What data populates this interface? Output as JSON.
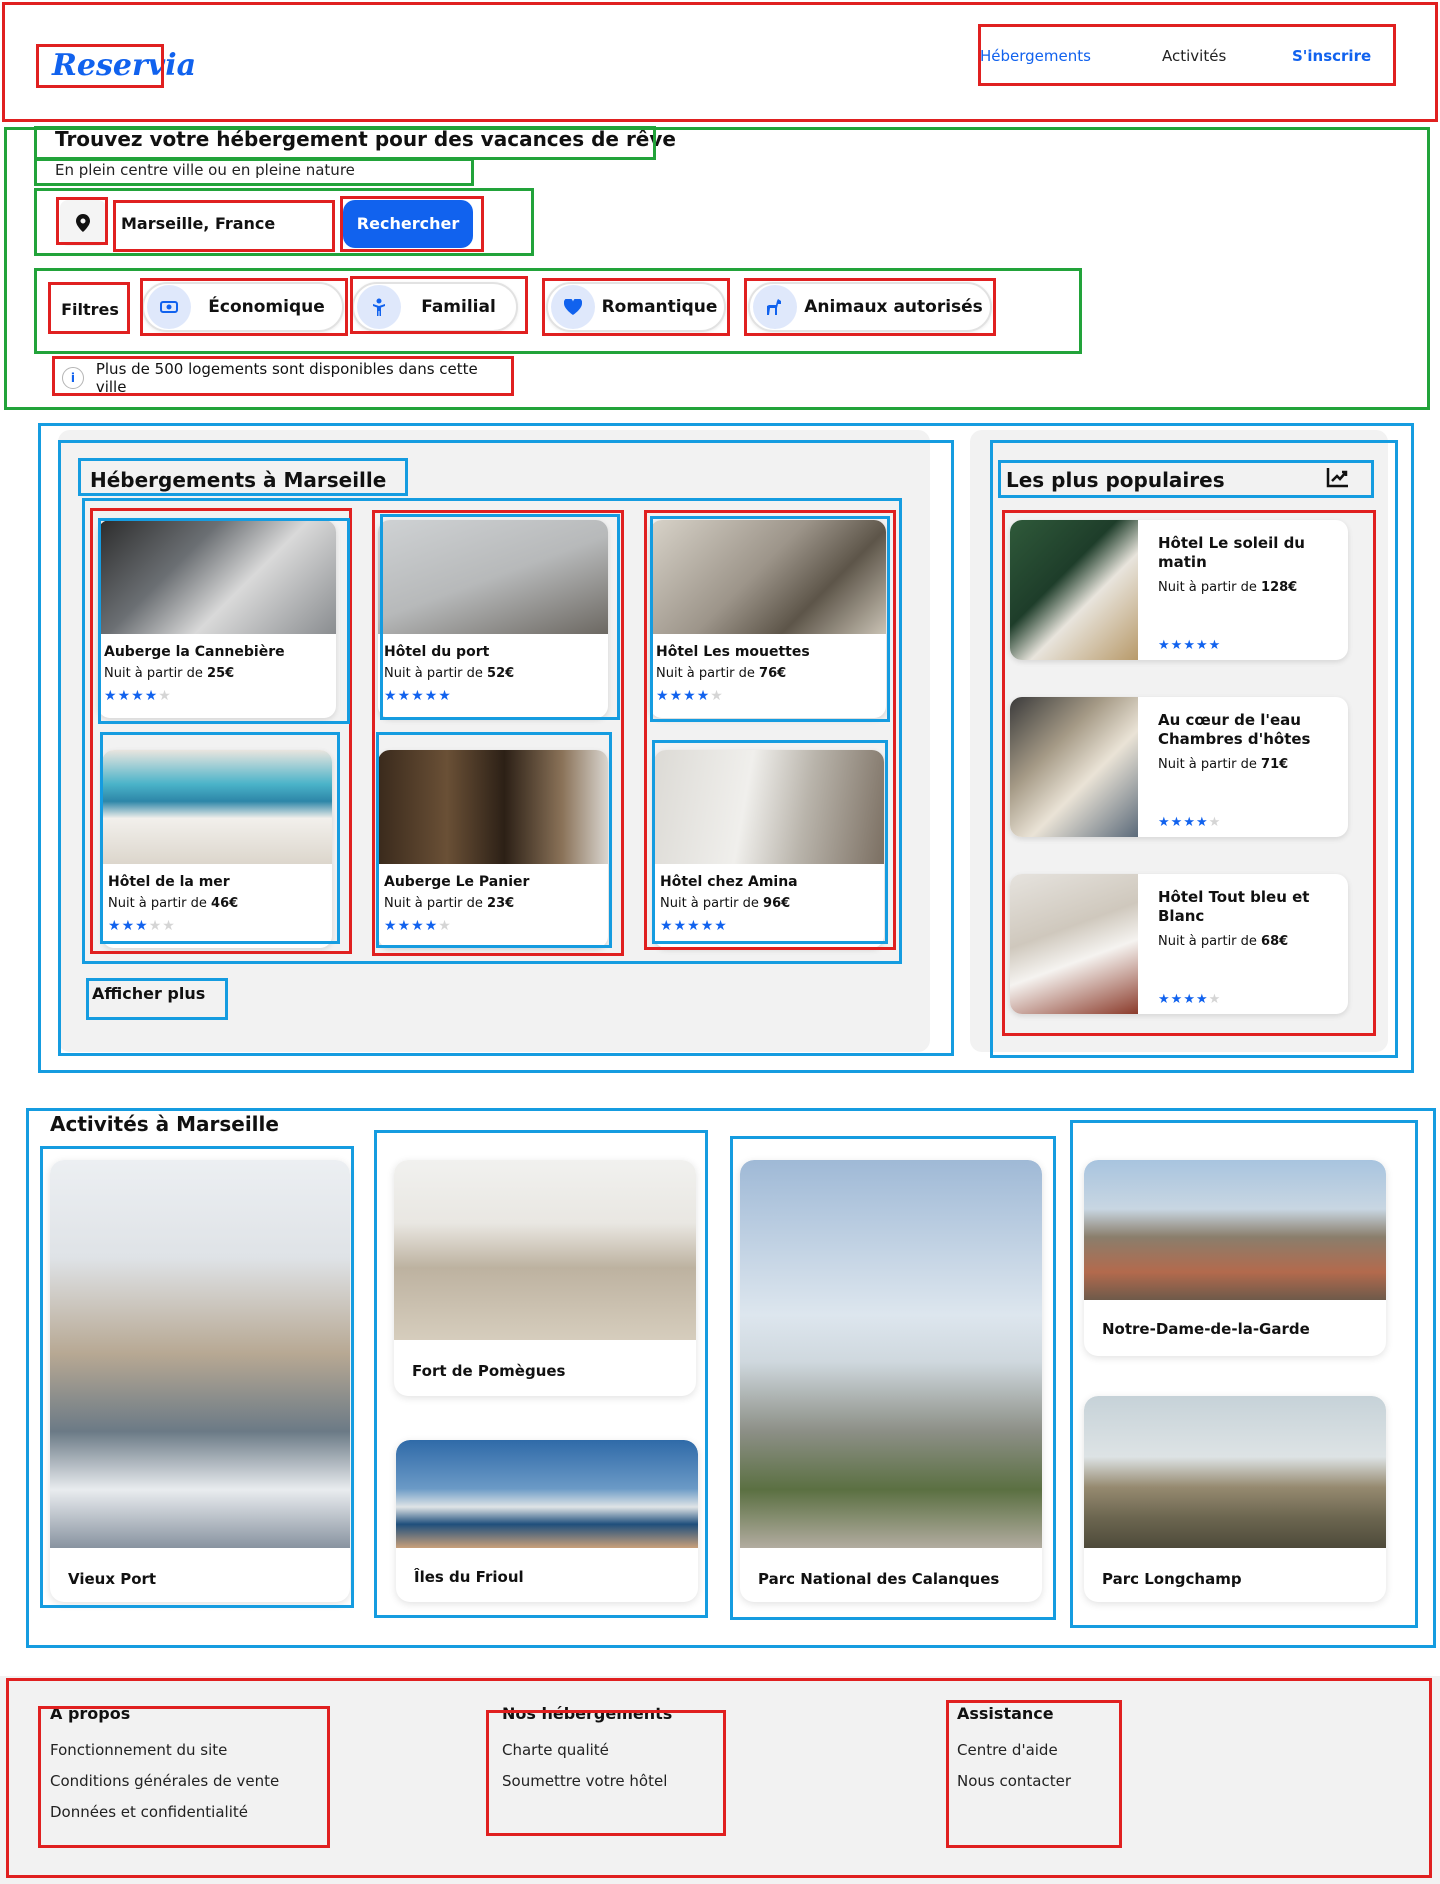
{
  "brand": {
    "logo": "Reservia",
    "accent": "#1162ee"
  },
  "nav": {
    "items": [
      "Hébergements",
      "Activités",
      "S'inscrire"
    ]
  },
  "search": {
    "title": "Trouvez votre hébergement pour des vacances de rêve",
    "subtitle": "En plein centre ville ou en pleine nature",
    "location_icon": "location-pin-icon",
    "location_value": "Marseille, France",
    "button": "Rechercher"
  },
  "filters": {
    "label": "Filtres",
    "chips": [
      {
        "label": "Économique",
        "icon": "money-icon"
      },
      {
        "label": "Familial",
        "icon": "child-icon"
      },
      {
        "label": "Romantique",
        "icon": "heart-icon"
      },
      {
        "label": "Animaux autorisés",
        "icon": "dog-icon"
      }
    ]
  },
  "info": {
    "text": "Plus de 500 logements sont disponibles dans cette ville",
    "icon": "info-icon"
  },
  "accommodations": {
    "title": "Hébergements à Marseille",
    "price_prefix": "Nuit à partir de",
    "items": [
      {
        "name": "Auberge la Cannebière",
        "price": "25€",
        "rating": 4
      },
      {
        "name": "Hôtel du port",
        "price": "52€",
        "rating": 5
      },
      {
        "name": "Hôtel Les mouettes",
        "price": "76€",
        "rating": 4
      },
      {
        "name": "Hôtel de la mer",
        "price": "46€",
        "rating": 3
      },
      {
        "name": "Auberge Le Panier",
        "price": "23€",
        "rating": 4
      },
      {
        "name": "Hôtel chez Amina",
        "price": "96€",
        "rating": 5
      }
    ],
    "show_more": "Afficher plus"
  },
  "popular": {
    "title": "Les plus populaires",
    "icon": "trending-up-icon",
    "items": [
      {
        "name": "Hôtel Le soleil du matin",
        "price": "128€",
        "rating": 5
      },
      {
        "name": "Au cœur de l'eau Chambres d'hôtes",
        "price": "71€",
        "rating": 4
      },
      {
        "name": "Hôtel Tout bleu et Blanc",
        "price": "68€",
        "rating": 4
      }
    ]
  },
  "activities": {
    "title": "Activités à Marseille",
    "items": [
      "Vieux Port",
      "Fort de Pomègues",
      "Îles du Frioul",
      "Parc National des Calanques",
      "Notre-Dame-de-la-Garde",
      "Parc Longchamp"
    ]
  },
  "footer": {
    "columns": [
      {
        "title": "A propos",
        "links": [
          "Fonctionnement du site",
          "Conditions générales de vente",
          "Données et confidentialité"
        ]
      },
      {
        "title": "Nos hébergements",
        "links": [
          "Charte qualité",
          "Soumettre votre hôtel"
        ]
      },
      {
        "title": "Assistance",
        "links": [
          "Centre d'aide",
          "Nous contacter"
        ]
      }
    ]
  }
}
